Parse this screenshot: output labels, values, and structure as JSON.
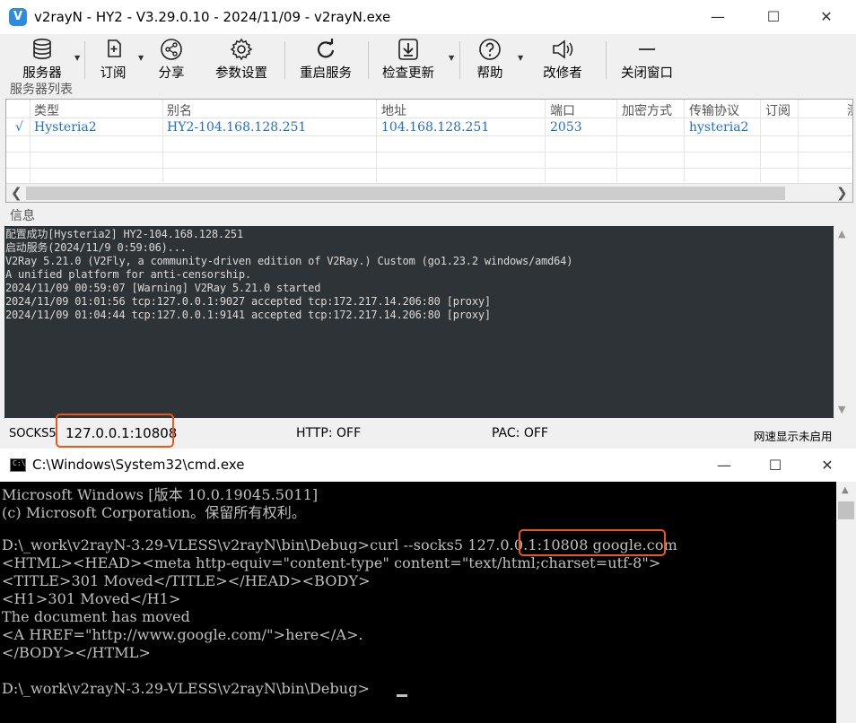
{
  "v2rayn": {
    "title": "v2rayN - HY2 - V3.29.0.10 - 2024/11/09 - v2rayN.exe",
    "toolbar": [
      {
        "label": "服务器",
        "icon": "database-icon",
        "dropdown": true
      },
      {
        "label": "订阅",
        "icon": "subscribe-icon",
        "dropdown": true
      },
      {
        "label": "分享",
        "icon": "share-icon",
        "dropdown": false
      },
      {
        "label": "参数设置",
        "icon": "gear-icon",
        "dropdown": false
      },
      {
        "label": "重启服务",
        "icon": "restart-icon",
        "dropdown": false
      },
      {
        "label": "检查更新",
        "icon": "download-icon",
        "dropdown": true
      },
      {
        "label": "帮助",
        "icon": "help-icon",
        "dropdown": true
      },
      {
        "label": "改修者",
        "icon": "speaker-icon",
        "dropdown": false
      },
      {
        "label": "关闭窗口",
        "icon": "minimize-icon",
        "dropdown": false
      }
    ],
    "server_list_label": "服务器列表",
    "columns": [
      "类型",
      "别名",
      "地址",
      "端口",
      "加密方式",
      "传输协议",
      "订阅",
      "测"
    ],
    "rows": [
      {
        "check": "√",
        "type": "Hysteria2",
        "alias": "HY2-104.168.128.251",
        "address": "104.168.128.251",
        "port": "2053",
        "security": "",
        "network": "hysteria2",
        "sub": ""
      }
    ],
    "info_label": "信息",
    "log": [
      "配置成功[Hysteria2] HY2-104.168.128.251",
      "启动服务(2024/11/9 0:59:06)...",
      "V2Ray 5.21.0 (V2Fly, a community-driven edition of V2Ray.) Custom (go1.23.2 windows/amd64)",
      "A unified platform for anti-censorship.",
      "2024/11/09 00:59:07 [Warning] V2Ray 5.21.0 started",
      "2024/11/09 01:01:56 tcp:127.0.0.1:9027 accepted tcp:172.217.14.206:80 [proxy]",
      "2024/11/09 01:04:44 tcp:127.0.0.1:9141 accepted tcp:172.217.14.206:80 [proxy]"
    ],
    "status": {
      "socks_label": "SOCKS5",
      "socks_value": "127.0.0.1:10808",
      "http": "HTTP:  OFF",
      "pac": "PAC:  OFF",
      "speed": "网速显示未启用"
    }
  },
  "cmd": {
    "title": "C:\\Windows\\System32\\cmd.exe",
    "icon_text": "C:\\",
    "lines": [
      "Microsoft Windows [版本 10.0.19045.5011]",
      "(c) Microsoft Corporation。保留所有权利。",
      "",
      "D:\\_work\\v2rayN-3.29-VLESS\\v2rayN\\bin\\Debug>curl --socks5 127.0.0.1:10808 google.com",
      "<HTML><HEAD><meta http-equiv=\"content-type\" content=\"text/html;charset=utf-8\">",
      "<TITLE>301 Moved</TITLE></HEAD><BODY>",
      "<H1>301 Moved</H1>",
      "The document has moved",
      "<A HREF=\"http://www.google.com/\">here</A>.",
      "</BODY></HTML>",
      "",
      "D:\\_work\\v2rayN-3.29-VLESS\\v2rayN\\bin\\Debug>"
    ]
  },
  "colors": {
    "highlight": "#e8581b",
    "link_blue": "#1f6fd2",
    "log_bg": "#2e3337",
    "console_bg": "#000000"
  }
}
